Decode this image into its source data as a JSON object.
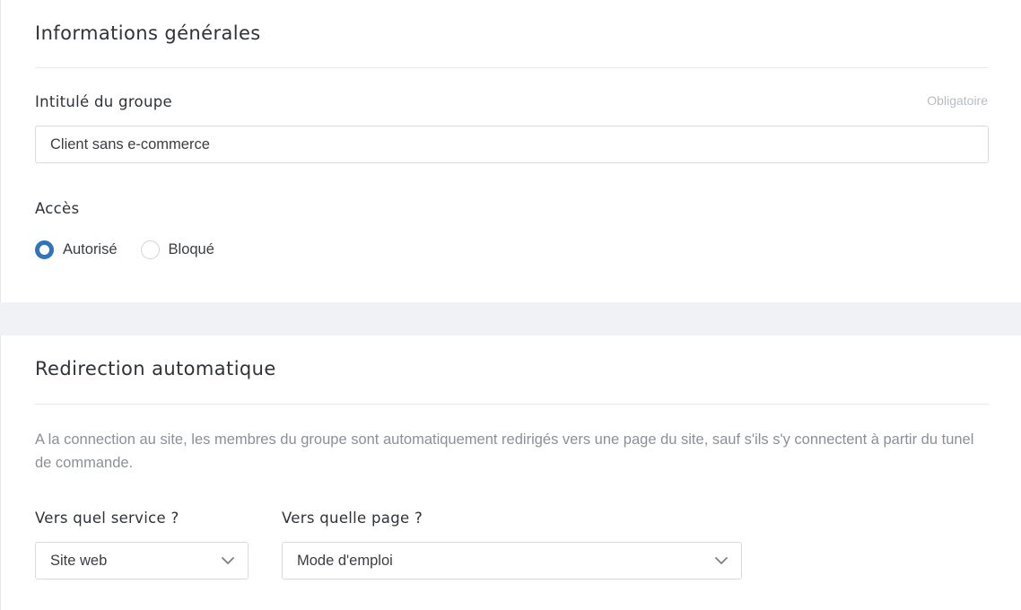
{
  "general": {
    "title": "Informations générales",
    "group_name": {
      "label": "Intitulé du groupe",
      "required_label": "Obligatoire",
      "value": "Client sans e-commerce"
    },
    "access": {
      "label": "Accès",
      "options": [
        {
          "label": "Autorisé",
          "checked": true
        },
        {
          "label": "Bloqué",
          "checked": false
        }
      ]
    }
  },
  "redirect": {
    "title": "Redirection automatique",
    "description": "A la connection au site, les membres du groupe sont automatiquement redirigés vers une page du site, sauf s'ils s'y connectent à partir du tunel de commande.",
    "service": {
      "label": "Vers quel service ?",
      "value": "Site web"
    },
    "page": {
      "label": "Vers quelle page ?",
      "value": "Mode d'emploi"
    }
  },
  "colors": {
    "accent": "#2f76b8",
    "page_background": "#f1f2f6",
    "muted_text": "#8c9096"
  },
  "icons": {
    "select_arrow": "chevron-down-icon"
  }
}
